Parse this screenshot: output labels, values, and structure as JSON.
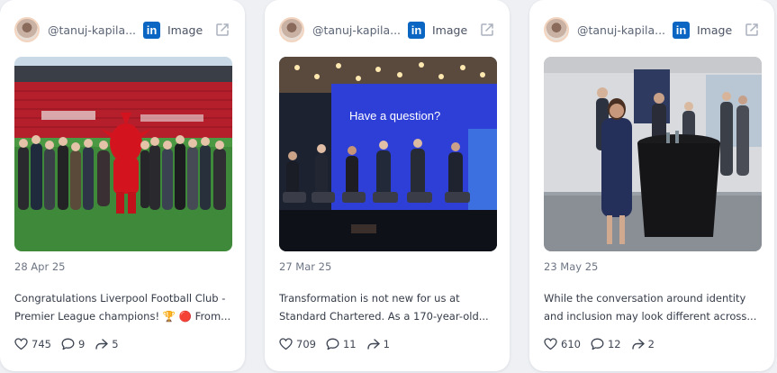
{
  "posts": [
    {
      "handle": "@tanuj-kapila...",
      "type": "Image",
      "date": "28 Apr 25",
      "text": "Congratulations Liverpool Football Club - Premier League champions! 🏆 🔴 From...",
      "likes": "745",
      "comments": "9",
      "shares": "5"
    },
    {
      "handle": "@tanuj-kapila...",
      "type": "Image",
      "date": "27 Mar 25",
      "text": "Transformation is not new for us at Standard Chartered. As a 170-year-old...",
      "likes": "709",
      "comments": "11",
      "shares": "1",
      "screen_text": "Have a question?"
    },
    {
      "handle": "@tanuj-kapila...",
      "type": "Image",
      "date": "23 May 25",
      "text": "While the conversation around identity and inclusion may look different across...",
      "likes": "610",
      "comments": "12",
      "shares": "2"
    }
  ],
  "colors": {
    "linkedin": "#0a66c2",
    "card": "#ffffff",
    "background": "#eef0f4"
  },
  "icons": {
    "network": "linkedin-icon",
    "open": "external-link-icon",
    "like": "heart-icon",
    "comment": "comment-icon",
    "share": "share-icon"
  }
}
